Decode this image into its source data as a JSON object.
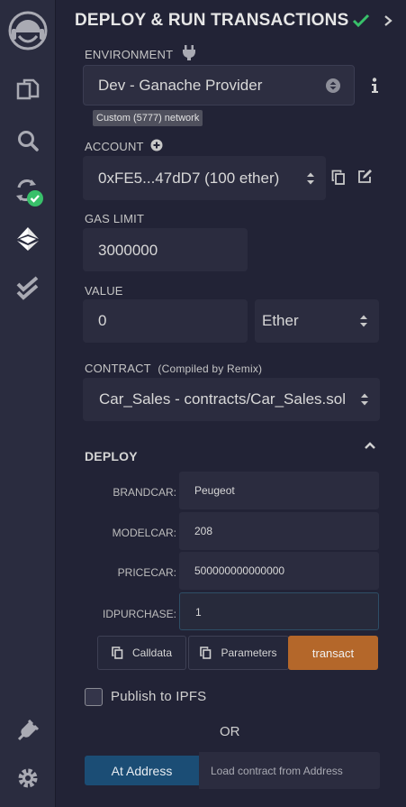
{
  "sidebar": {
    "icons": [
      "remix-logo-icon",
      "file-explorer-icon",
      "search-icon",
      "solidity-compiler-icon",
      "deploy-run-icon",
      "testing-icon",
      "plugin-manager-icon",
      "settings-icon"
    ]
  },
  "panel": {
    "title": "DEPLOY & RUN TRANSACTIONS"
  },
  "environment": {
    "label": "ENVIRONMENT",
    "value": "Dev - Ganache Provider",
    "network_badge": "Custom (5777) network"
  },
  "account": {
    "label": "ACCOUNT",
    "value": "0xFE5...47dD7 (100 ether)"
  },
  "gas_limit": {
    "label": "GAS LIMIT",
    "value": "3000000"
  },
  "value": {
    "label": "VALUE",
    "amount": "0",
    "unit": "Ether"
  },
  "contract": {
    "label": "CONTRACT",
    "sublabel": "(Compiled by Remix)",
    "value": "Car_Sales - contracts/Car_Sales.sol"
  },
  "deploy": {
    "title": "DEPLOY",
    "params": [
      {
        "name": "BRANDCAR:",
        "value": "Peugeot"
      },
      {
        "name": "MODELCAR:",
        "value": "208"
      },
      {
        "name": "PRICECAR:",
        "value": "500000000000000"
      },
      {
        "name": "IDPURCHASE:",
        "value": "1"
      }
    ],
    "calldata_label": "Calldata",
    "parameters_label": "Parameters",
    "transact_label": "transact"
  },
  "publish_ipfs_label": "Publish to IPFS",
  "or_label": "OR",
  "at_address": {
    "button_label": "At Address",
    "placeholder": "Load contract from Address"
  },
  "colors": {
    "background": "#222336",
    "sidebar": "#2a2c3f",
    "input": "#2b2c3f",
    "transact": "#b4672a",
    "at_address": "#1b4d75",
    "success": "#38c06a"
  }
}
